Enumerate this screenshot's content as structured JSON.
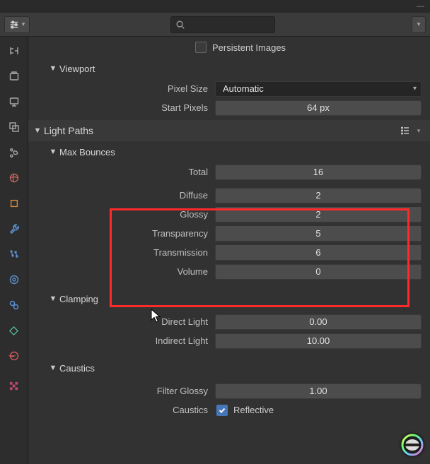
{
  "header": {
    "search_placeholder": ""
  },
  "persistent_images": {
    "label": "Persistent Images",
    "checked": false
  },
  "viewport": {
    "title": "Viewport",
    "pixel_size": {
      "label": "Pixel Size",
      "value": "Automatic"
    },
    "start_pixels": {
      "label": "Start Pixels",
      "value": "64 px"
    }
  },
  "light_paths": {
    "title": "Light Paths",
    "max_bounces": {
      "title": "Max Bounces",
      "total": {
        "label": "Total",
        "value": "16"
      },
      "diffuse": {
        "label": "Diffuse",
        "value": "2"
      },
      "glossy": {
        "label": "Glossy",
        "value": "2"
      },
      "transparency": {
        "label": "Transparency",
        "value": "5"
      },
      "transmission": {
        "label": "Transmission",
        "value": "6"
      },
      "volume": {
        "label": "Volume",
        "value": "0"
      }
    },
    "clamping": {
      "title": "Clamping",
      "direct": {
        "label": "Direct Light",
        "value": "0.00"
      },
      "indirect": {
        "label": "Indirect Light",
        "value": "10.00"
      }
    },
    "caustics": {
      "title": "Caustics",
      "filter_glossy": {
        "label": "Filter Glossy",
        "value": "1.00"
      },
      "caustics_label": "Caustics",
      "reflective": {
        "label": "Reflective",
        "checked": true
      }
    }
  }
}
